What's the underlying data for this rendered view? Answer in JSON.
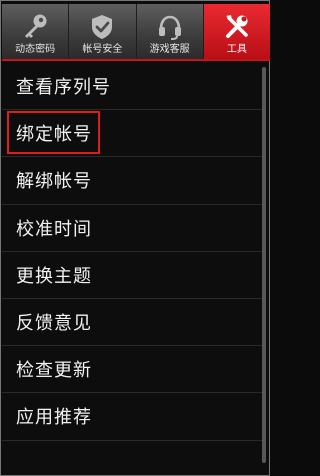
{
  "tabs": [
    {
      "label": "动态密码",
      "icon": "key-icon",
      "active": false
    },
    {
      "label": "帐号安全",
      "icon": "shield-check-icon",
      "active": false
    },
    {
      "label": "游戏客服",
      "icon": "headset-icon",
      "active": false
    },
    {
      "label": "工具",
      "icon": "tools-icon",
      "active": true
    }
  ],
  "menu": [
    {
      "label": "查看序列号"
    },
    {
      "label": "绑定帐号"
    },
    {
      "label": "解绑帐号"
    },
    {
      "label": "校准时间"
    },
    {
      "label": "更换主题"
    },
    {
      "label": "反馈意见"
    },
    {
      "label": "检查更新"
    },
    {
      "label": "应用推荐"
    }
  ],
  "colors": {
    "accent": "#d81e25",
    "highlight_box": "#e01c1c",
    "background": "#0d0d0d"
  }
}
